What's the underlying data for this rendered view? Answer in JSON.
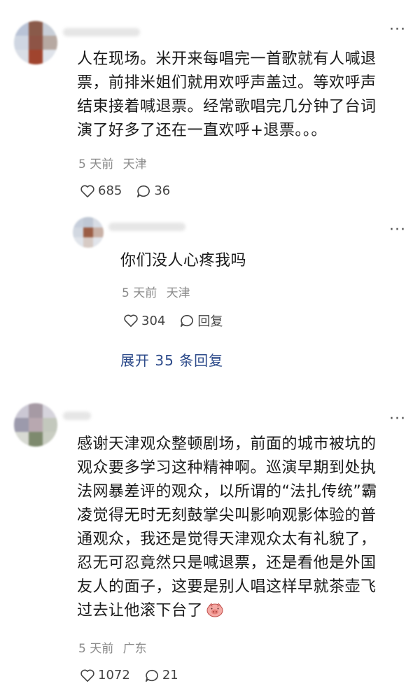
{
  "comments": [
    {
      "text_lines": [
        "人在现场。米开来每唱完一首歌就有人喊退",
        "票，前排米姐们就用欢呼声盖过。等欢呼声",
        "结束接着喊退票。经常歌唱完几分钟了台词",
        "演了好多了还在一直欢呼+退票。。。"
      ],
      "time": "5 天前",
      "location": "天津",
      "likes": "685",
      "replies_count": "36",
      "more_icon": "more-dots-icon"
    },
    {
      "text_lines": [
        "你们没人心疼我吗"
      ],
      "time": "5 天前",
      "location": "天津",
      "likes": "304",
      "reply_label": "回复",
      "expand_label": "展开 35 条回复"
    },
    {
      "text_lines": [
        "感谢天津观众整顿剧场，前面的城市被坑的",
        "观众要多学习这种精神啊。巡演早期到处执",
        "法网暴差评的观众，以所谓的“法扎传统”霸",
        "凌觉得无时无刻鼓掌尖叫影响观影体验的普",
        "通观众，我还是觉得天津观众太有礼貌了，",
        "忍无可忍竟然只是喊退票，还是看他是外国",
        "友人的面子，这要是别人唱这样早就茶壶飞",
        "过去让他滚下台了"
      ],
      "time": "5 天前",
      "location": "广东",
      "likes": "1072",
      "replies_count": "21"
    }
  ],
  "colors": {
    "link": "#2c4a8a",
    "meta": "#8a8a8a"
  }
}
